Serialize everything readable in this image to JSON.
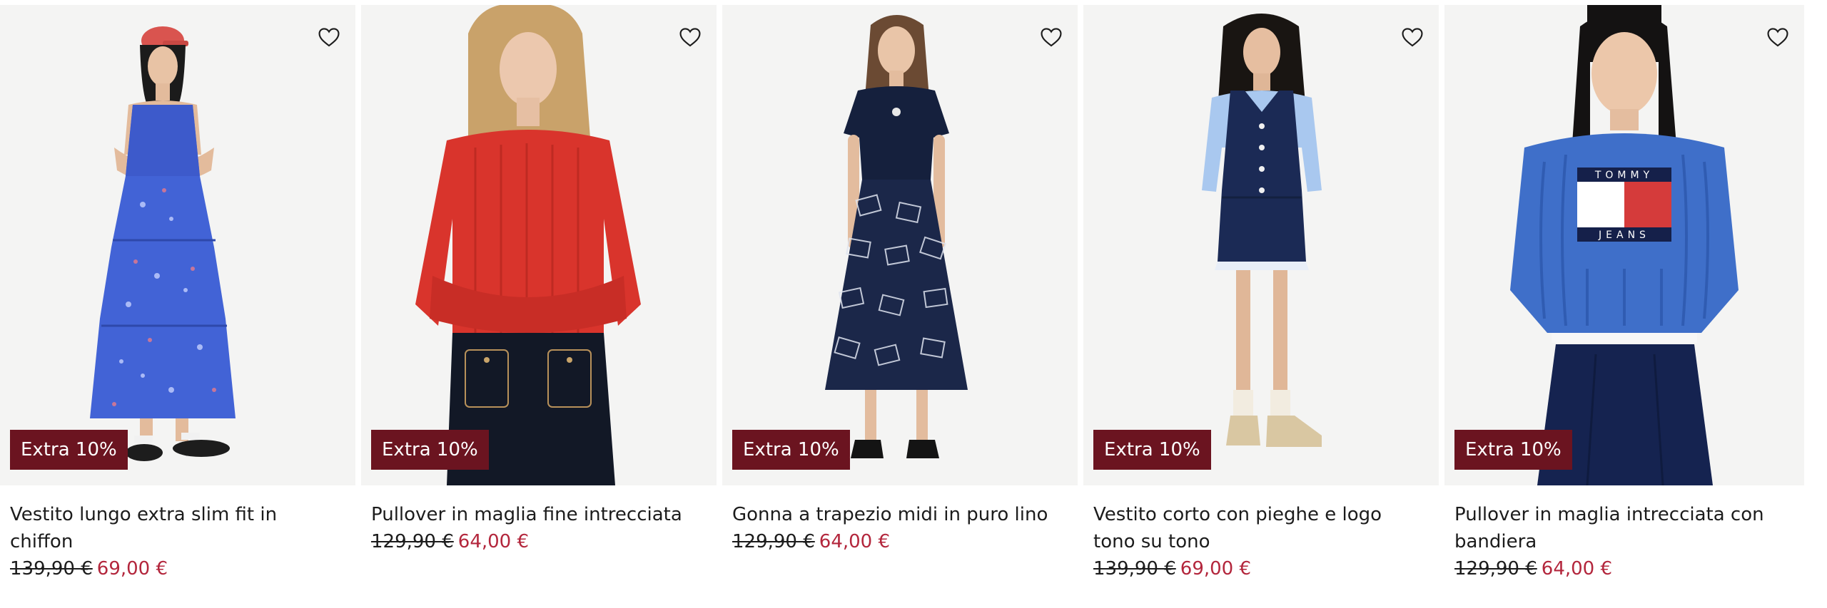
{
  "colors": {
    "badge_bg": "#6b1420",
    "sale_price": "#b3263c",
    "image_bg": "#f4f4f3"
  },
  "products": [
    {
      "title": "Vestito lungo extra slim fit in chiffon",
      "badge": "Extra 10%",
      "old_price": "139,90 €",
      "new_price": "69,00 €",
      "image_icon": "floral-maxi-dress-photo"
    },
    {
      "title": "Pullover in maglia fine intrecciata",
      "badge": "Extra 10%",
      "old_price": "129,90 €",
      "new_price": "64,00 €",
      "image_icon": "red-cable-knit-sweater-photo"
    },
    {
      "title": "Gonna a trapezio midi in puro lino",
      "badge": "Extra 10%",
      "old_price": "129,90 €",
      "new_price": "64,00 €",
      "image_icon": "printed-midi-skirt-photo"
    },
    {
      "title": "Vestito corto con pieghe e logo tono su tono",
      "badge": "Extra 10%",
      "old_price": "139,90 €",
      "new_price": "69,00 €",
      "image_icon": "navy-pinafore-dress-photo"
    },
    {
      "title": "Pullover in maglia intrecciata con bandiera",
      "badge": "Extra 10%",
      "old_price": "129,90 €",
      "new_price": "64,00 €",
      "image_icon": "flag-cable-knit-sweater-photo",
      "logo_text_top": "TOMMY",
      "logo_text_bottom": "JEANS"
    }
  ]
}
